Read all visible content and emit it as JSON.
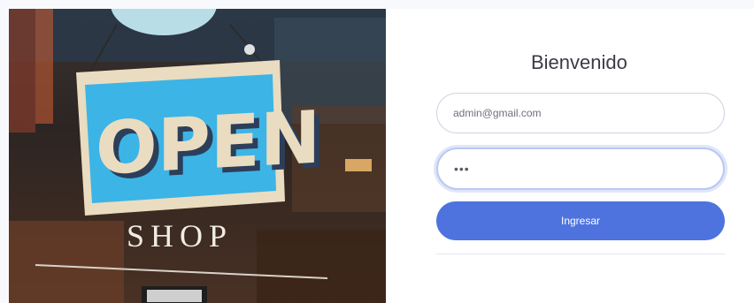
{
  "login": {
    "title": "Bienvenido",
    "email_value": "admin@gmail.com",
    "password_masked": "•••",
    "submit_label": "Ingresar"
  },
  "photo": {
    "sign_word": "OPEN",
    "shop_word": "SHOP"
  },
  "colors": {
    "primary": "#4e73df",
    "sign_blue": "#3cb4e6",
    "sign_letters": "#e9dcc0"
  }
}
